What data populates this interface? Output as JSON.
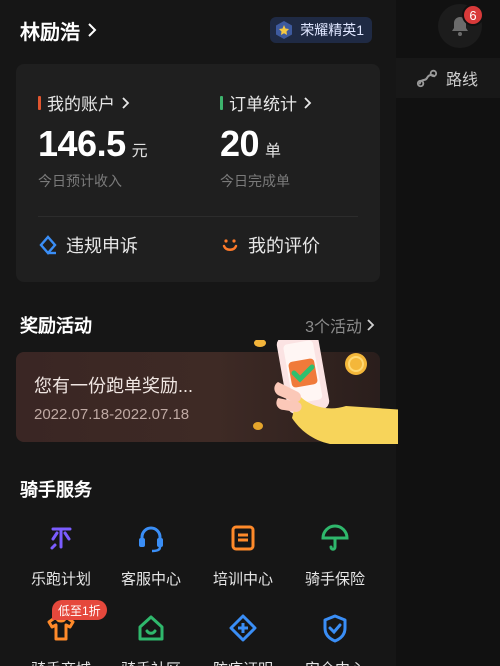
{
  "map_controls": {
    "notification_count": "6",
    "route_label": "路线"
  },
  "header": {
    "rider_name": "林励浩",
    "level_badge": "荣耀精英1"
  },
  "stats": {
    "account": {
      "title": "我的账户",
      "value": "146.5",
      "unit": "元",
      "subtitle": "今日预计收入"
    },
    "orders": {
      "title": "订单统计",
      "value": "20",
      "unit": "单",
      "subtitle": "今日完成单"
    },
    "quick_links": {
      "appeal": "违规申诉",
      "reviews": "我的评价"
    },
    "colors": {
      "account_bar": "#e0552f",
      "orders_bar": "#3db46d"
    }
  },
  "rewards": {
    "title": "奖励活动",
    "more": "3个活动",
    "card_title": "您有一份跑单奖励...",
    "card_date": "2022.07.18-2022.07.18"
  },
  "services": {
    "title": "骑手服务",
    "items": [
      {
        "label": "乐跑计划",
        "icon": "le-icon",
        "color": "#7b5cff"
      },
      {
        "label": "客服中心",
        "icon": "headset-icon",
        "color": "#3a8ef6"
      },
      {
        "label": "培训中心",
        "icon": "training-icon",
        "color": "#ff8a2a"
      },
      {
        "label": "骑手保险",
        "icon": "umbrella-icon",
        "color": "#2fb86c"
      },
      {
        "label": "骑手商城",
        "icon": "shirt-icon",
        "color": "#ff8a2a"
      },
      {
        "label": "骑手社区",
        "icon": "home-icon",
        "color": "#2fb86c"
      },
      {
        "label": "防疫证明",
        "icon": "medical-icon",
        "color": "#3a8ef6"
      },
      {
        "label": "安全中心",
        "icon": "shield-icon",
        "color": "#3a8ef6"
      }
    ],
    "promo_tag": "低至1折"
  }
}
